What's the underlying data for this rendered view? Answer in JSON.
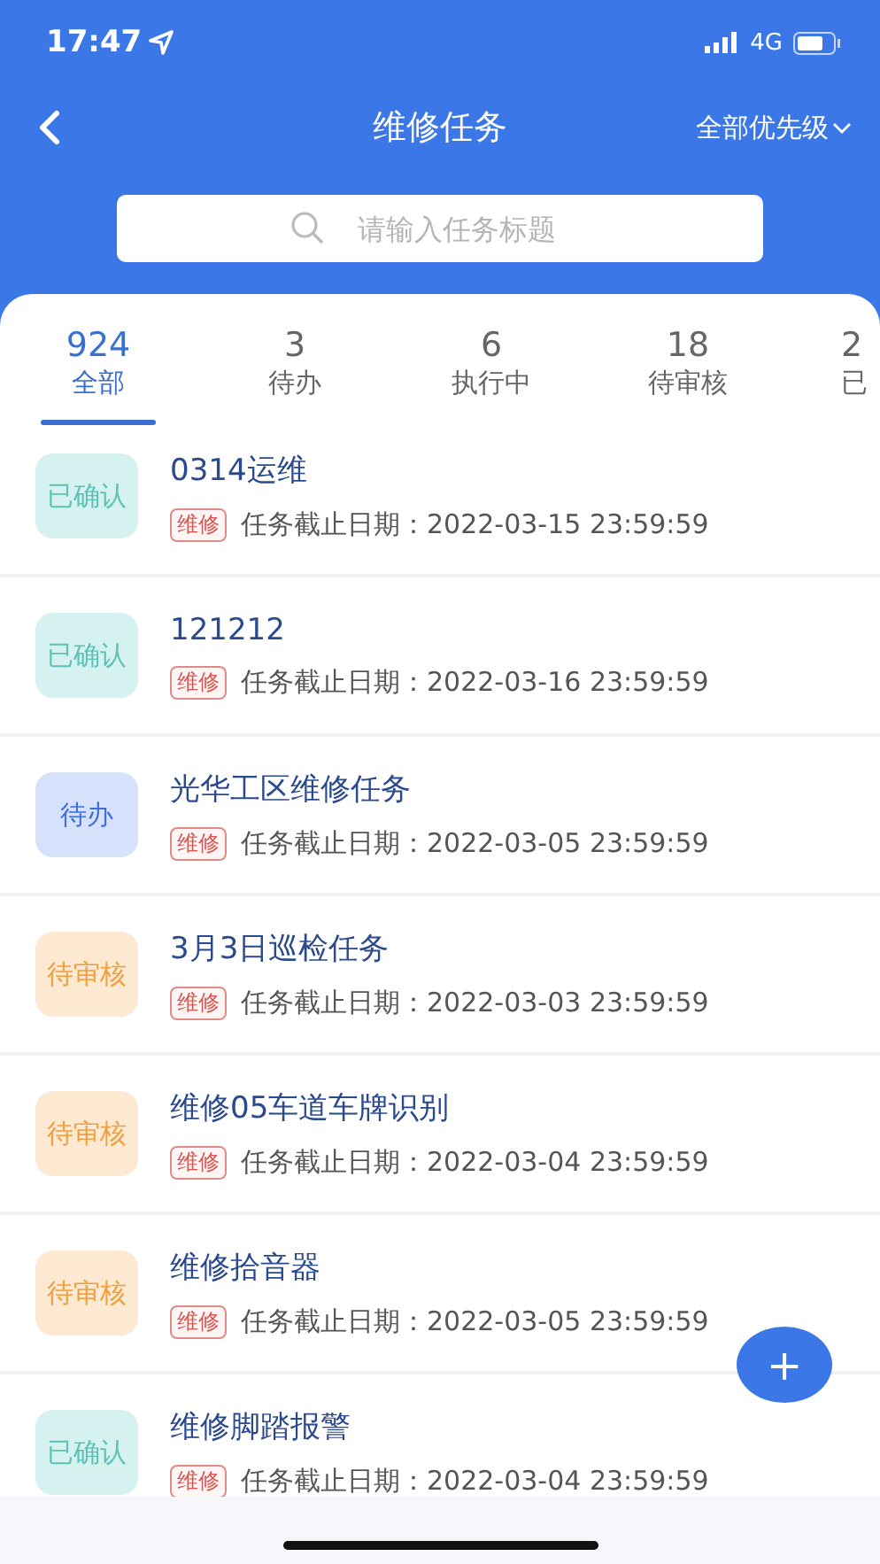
{
  "status_bar": {
    "time": "17:47",
    "network": "4G"
  },
  "nav": {
    "title": "维修任务",
    "filter": "全部优先级"
  },
  "search": {
    "placeholder": "请输入任务标题"
  },
  "tabs": [
    {
      "count": "924",
      "label": "全部",
      "selected": true
    },
    {
      "count": "3",
      "label": "待办",
      "selected": false
    },
    {
      "count": "6",
      "label": "执行中",
      "selected": false
    },
    {
      "count": "18",
      "label": "待审核",
      "selected": false
    },
    {
      "count": "2",
      "label": "已",
      "selected": false
    }
  ],
  "tasks": [
    {
      "status": "已确认",
      "kind": "confirmed",
      "title": "0314运维",
      "tag": "维修",
      "deadline": "任务截止日期：2022-03-15 23:59:59"
    },
    {
      "status": "已确认",
      "kind": "confirmed",
      "title": "121212",
      "tag": "维修",
      "deadline": "任务截止日期：2022-03-16 23:59:59"
    },
    {
      "status": "待办",
      "kind": "todo",
      "title": "光华工区维修任务",
      "tag": "维修",
      "deadline": "任务截止日期：2022-03-05 23:59:59"
    },
    {
      "status": "待审核",
      "kind": "review",
      "title": "3月3日巡检任务",
      "tag": "维修",
      "deadline": "任务截止日期：2022-03-03 23:59:59"
    },
    {
      "status": "待审核",
      "kind": "review",
      "title": "维修05车道车牌识别",
      "tag": "维修",
      "deadline": "任务截止日期：2022-03-04 23:59:59"
    },
    {
      "status": "待审核",
      "kind": "review",
      "title": "维修拾音器",
      "tag": "维修",
      "deadline": "任务截止日期：2022-03-05 23:59:59"
    },
    {
      "status": "已确认",
      "kind": "confirmed",
      "title": "维修脚踏报警",
      "tag": "维修",
      "deadline": "任务截止日期：2022-03-04 23:59:59"
    }
  ],
  "add_button": {
    "label": "+"
  }
}
